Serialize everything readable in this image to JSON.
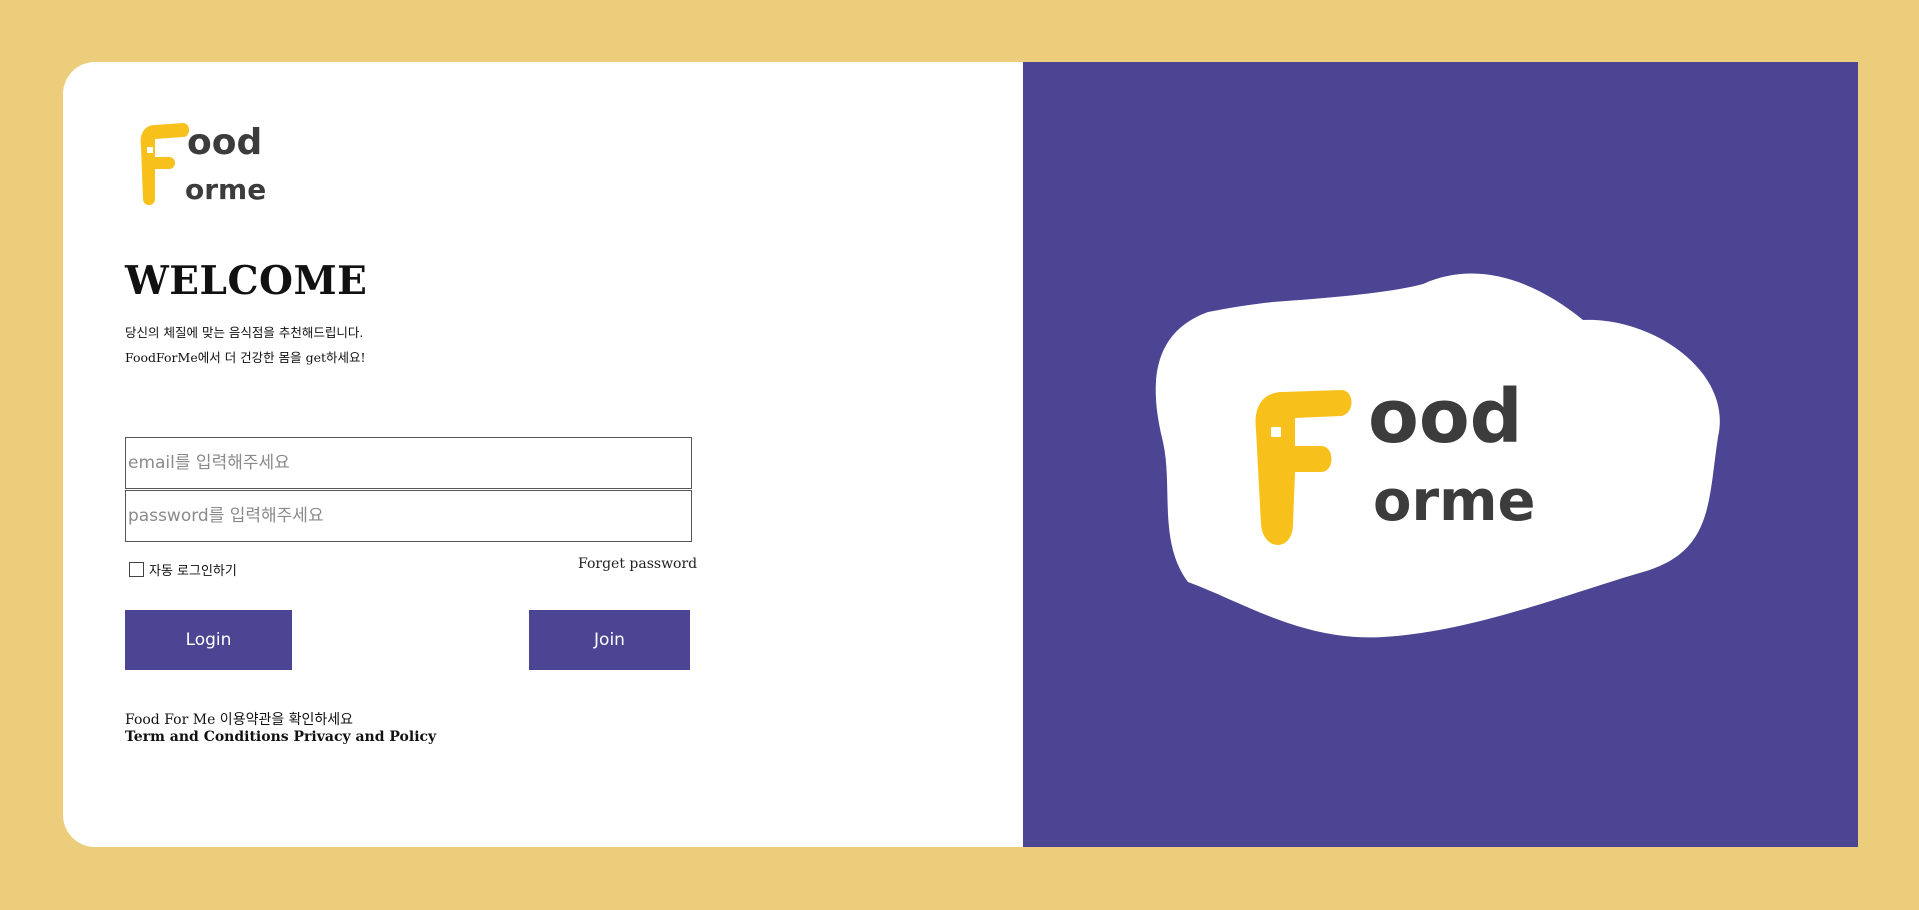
{
  "brand": {
    "logo_text_top": "ood",
    "logo_text_bottom": "orme",
    "logo_letter": "F",
    "colors": {
      "background": "#eccd7c",
      "accent": "#4b4593",
      "logo_yellow": "#f7c01a",
      "logo_dark": "#3c3c3c"
    }
  },
  "hero": {
    "title": "WELCOME",
    "description_line1": "당신의 체질에 맞는 음식점을 추천해드립니다.",
    "description_line2": "FoodForMe에서 더 건강한 몸을 get하세요!"
  },
  "form": {
    "email_placeholder": "email를 입력해주세요",
    "password_placeholder": "password를 입력해주세요",
    "auto_login_label": "자동 로그인하기",
    "forget_password_label": "Forget password",
    "login_label": "Login",
    "join_label": "Join"
  },
  "footer": {
    "terms_line1": "Food For Me 이용약관을 확인하세요",
    "terms_line2": "Term and Conditions Privacy and Policy"
  }
}
